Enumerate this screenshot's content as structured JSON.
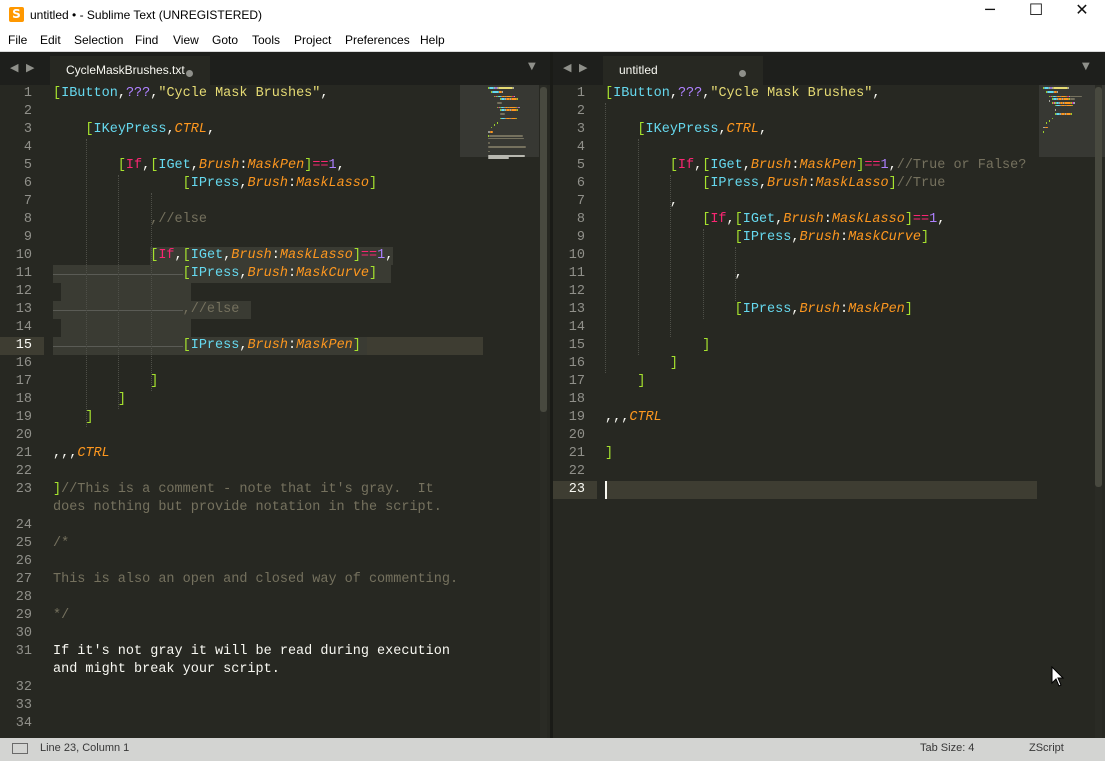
{
  "window": {
    "title": "untitled • - Sublime Text (UNREGISTERED)",
    "controls": {
      "minimize": "─",
      "maximize": "☐",
      "close": "✕"
    }
  },
  "app_icon": {
    "icon": "sublime-text-icon",
    "glyph": "S"
  },
  "menu": [
    "File",
    "Edit",
    "Selection",
    "Find",
    "View",
    "Goto",
    "Tools",
    "Project",
    "Preferences",
    "Help"
  ],
  "theme": {
    "background": "#272822",
    "foreground": "#f8f8f2",
    "comment": "#75715e",
    "string": "#e6db74",
    "bracket": "#a6e22e",
    "keyword": "#66d9ef",
    "parameter": "#fd971f",
    "operator": "#f92672",
    "number": "#ae81ff"
  },
  "left_pane": {
    "tab_label": "CycleMaskBrushes.txt",
    "nav_arrows": "◀ ▶",
    "tab_menu": "▼",
    "current_line": "15",
    "lines": [
      [
        [
          "g",
          "["
        ],
        [
          "b",
          "IButton"
        ],
        [
          "w",
          ","
        ],
        [
          "n",
          "???"
        ],
        [
          "w",
          ","
        ],
        [
          "y",
          "\"Cycle Mask Brushes\""
        ],
        [
          "w",
          ","
        ]
      ],
      [],
      [
        [
          "w",
          "    "
        ],
        [
          "g",
          "["
        ],
        [
          "b",
          "IKeyPress"
        ],
        [
          "w",
          ","
        ],
        [
          "o",
          "CTRL"
        ],
        [
          "w",
          ","
        ]
      ],
      [],
      [
        [
          "w",
          "        "
        ],
        [
          "g",
          "["
        ],
        [
          "p",
          "If"
        ],
        [
          "w",
          ","
        ],
        [
          "g",
          "["
        ],
        [
          "b",
          "IGet"
        ],
        [
          "w",
          ","
        ],
        [
          "o",
          "Brush"
        ],
        [
          "w",
          ":"
        ],
        [
          "o",
          "MaskPen"
        ],
        [
          "g",
          "]"
        ],
        [
          "p",
          "=="
        ],
        [
          "n",
          "1"
        ],
        [
          "w",
          ","
        ]
      ],
      [
        [
          "w",
          "                "
        ],
        [
          "g",
          "["
        ],
        [
          "b",
          "IPress"
        ],
        [
          "w",
          ","
        ],
        [
          "o",
          "Brush"
        ],
        [
          "w",
          ":"
        ],
        [
          "o",
          "MaskLasso"
        ],
        [
          "g",
          "]"
        ]
      ],
      [],
      [
        [
          "w",
          "            "
        ],
        [
          "c",
          ",//else"
        ]
      ],
      [],
      [
        [
          "w",
          "            "
        ],
        [
          "g",
          "["
        ],
        [
          "p",
          "If"
        ],
        [
          "w",
          ","
        ],
        [
          "g",
          "["
        ],
        [
          "b",
          "IGet"
        ],
        [
          "w",
          ","
        ],
        [
          "o",
          "Brush"
        ],
        [
          "w",
          ":"
        ],
        [
          "o",
          "MaskLasso"
        ],
        [
          "g",
          "]"
        ],
        [
          "p",
          "=="
        ],
        [
          "n",
          "1"
        ],
        [
          "w",
          ","
        ]
      ],
      [
        [
          "w",
          "                "
        ],
        [
          "g",
          "["
        ],
        [
          "b",
          "IPress"
        ],
        [
          "w",
          ","
        ],
        [
          "o",
          "Brush"
        ],
        [
          "w",
          ":"
        ],
        [
          "o",
          "MaskCurve"
        ],
        [
          "g",
          "]"
        ]
      ],
      [],
      [
        [
          "w",
          "                "
        ],
        [
          "c",
          ",//else"
        ]
      ],
      [],
      [
        [
          "w",
          "                "
        ],
        [
          "g",
          "["
        ],
        [
          "b",
          "IPress"
        ],
        [
          "w",
          ","
        ],
        [
          "o",
          "Brush"
        ],
        [
          "w",
          ":"
        ],
        [
          "o",
          "MaskPen"
        ],
        [
          "g",
          "]"
        ]
      ],
      [],
      [
        [
          "w",
          "            "
        ],
        [
          "g",
          "]"
        ]
      ],
      [
        [
          "w",
          "        "
        ],
        [
          "g",
          "]"
        ]
      ],
      [
        [
          "w",
          "    "
        ],
        [
          "g",
          "]"
        ]
      ],
      [],
      [
        [
          "w",
          ",,,"
        ],
        [
          "o",
          "CTRL"
        ]
      ],
      [],
      [
        [
          "g",
          "]"
        ],
        [
          "c",
          "//This is a comment - note that it's gray.  It"
        ]
      ],
      [
        [
          "c",
          "does nothing but provide notation in the script."
        ]
      ],
      [],
      [
        [
          "c",
          "/*"
        ]
      ],
      [],
      [
        [
          "c",
          "This is also an open and closed way of commenting."
        ]
      ],
      [],
      [
        [
          "c",
          "*/"
        ]
      ],
      [],
      [
        [
          "w",
          "If it's not gray it will be read during execution"
        ]
      ],
      [
        [
          "w",
          "and might break your script."
        ]
      ],
      [],
      [],
      []
    ],
    "line_numbers": [
      "1",
      "2",
      "3",
      "4",
      "5",
      "6",
      "7",
      "8",
      "9",
      "10",
      "11",
      "12",
      "13",
      "14",
      "15",
      "16",
      "17",
      "18",
      "19",
      "20",
      "21",
      "22",
      "23",
      "",
      "24",
      "25",
      "26",
      "27",
      "28",
      "29",
      "30",
      "31",
      "",
      "32",
      "33",
      "34"
    ]
  },
  "right_pane": {
    "tab_label": "untitled",
    "nav_arrows": "◀ ▶",
    "tab_menu": "▼",
    "current_line": "23",
    "lines": [
      [
        [
          "g",
          "["
        ],
        [
          "b",
          "IButton"
        ],
        [
          "w",
          ","
        ],
        [
          "n",
          "???"
        ],
        [
          "w",
          ","
        ],
        [
          "y",
          "\"Cycle Mask Brushes\""
        ],
        [
          "w",
          ","
        ]
      ],
      [],
      [
        [
          "w",
          "    "
        ],
        [
          "g",
          "["
        ],
        [
          "b",
          "IKeyPress"
        ],
        [
          "w",
          ","
        ],
        [
          "o",
          "CTRL"
        ],
        [
          "w",
          ","
        ]
      ],
      [],
      [
        [
          "w",
          "        "
        ],
        [
          "g",
          "["
        ],
        [
          "p",
          "If"
        ],
        [
          "w",
          ","
        ],
        [
          "g",
          "["
        ],
        [
          "b",
          "IGet"
        ],
        [
          "w",
          ","
        ],
        [
          "o",
          "Brush"
        ],
        [
          "w",
          ":"
        ],
        [
          "o",
          "MaskPen"
        ],
        [
          "g",
          "]"
        ],
        [
          "p",
          "=="
        ],
        [
          "n",
          "1"
        ],
        [
          "w",
          ","
        ],
        [
          "c",
          "//True or False?"
        ]
      ],
      [
        [
          "w",
          "            "
        ],
        [
          "g",
          "["
        ],
        [
          "b",
          "IPress"
        ],
        [
          "w",
          ","
        ],
        [
          "o",
          "Brush"
        ],
        [
          "w",
          ":"
        ],
        [
          "o",
          "MaskLasso"
        ],
        [
          "g",
          "]"
        ],
        [
          "c",
          "//True"
        ]
      ],
      [
        [
          "w",
          "        "
        ],
        [
          "w",
          ","
        ]
      ],
      [
        [
          "w",
          "            "
        ],
        [
          "g",
          "["
        ],
        [
          "p",
          "If"
        ],
        [
          "w",
          ","
        ],
        [
          "g",
          "["
        ],
        [
          "b",
          "IGet"
        ],
        [
          "w",
          ","
        ],
        [
          "o",
          "Brush"
        ],
        [
          "w",
          ":"
        ],
        [
          "o",
          "MaskLasso"
        ],
        [
          "g",
          "]"
        ],
        [
          "p",
          "=="
        ],
        [
          "n",
          "1"
        ],
        [
          "w",
          ","
        ]
      ],
      [
        [
          "w",
          "                "
        ],
        [
          "g",
          "["
        ],
        [
          "b",
          "IPress"
        ],
        [
          "w",
          ","
        ],
        [
          "o",
          "Brush"
        ],
        [
          "w",
          ":"
        ],
        [
          "o",
          "MaskCurve"
        ],
        [
          "g",
          "]"
        ]
      ],
      [],
      [
        [
          "w",
          "                "
        ],
        [
          "w",
          ","
        ]
      ],
      [],
      [
        [
          "w",
          "                "
        ],
        [
          "g",
          "["
        ],
        [
          "b",
          "IPress"
        ],
        [
          "w",
          ","
        ],
        [
          "o",
          "Brush"
        ],
        [
          "w",
          ":"
        ],
        [
          "o",
          "MaskPen"
        ],
        [
          "g",
          "]"
        ]
      ],
      [],
      [
        [
          "w",
          "            "
        ],
        [
          "g",
          "]"
        ]
      ],
      [
        [
          "w",
          "        "
        ],
        [
          "g",
          "]"
        ]
      ],
      [
        [
          "w",
          "    "
        ],
        [
          "g",
          "]"
        ]
      ],
      [],
      [
        [
          "w",
          ",,,"
        ],
        [
          "o",
          "CTRL"
        ]
      ],
      [],
      [
        [
          "g",
          "]"
        ]
      ],
      [],
      []
    ],
    "line_numbers": [
      "1",
      "2",
      "3",
      "4",
      "5",
      "6",
      "7",
      "8",
      "9",
      "10",
      "11",
      "12",
      "13",
      "14",
      "15",
      "16",
      "17",
      "18",
      "19",
      "20",
      "21",
      "22",
      "23"
    ]
  },
  "status": {
    "position": "Line 23, Column 1",
    "tab_size": "Tab Size: 4",
    "syntax": "ZScript",
    "panel_icon": "panel-toggle-icon"
  },
  "cursor": {
    "icon": "mouse-pointer-icon"
  }
}
